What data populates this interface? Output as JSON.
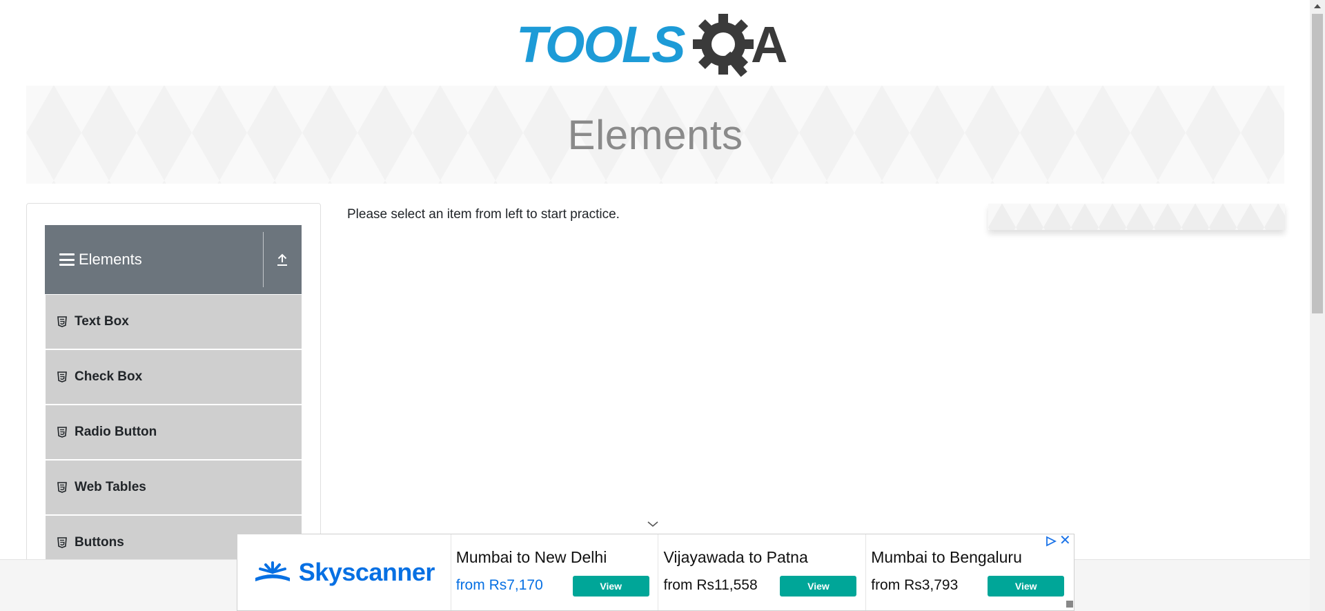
{
  "header": {
    "logo_part1": "TOOLS",
    "logo_part2": "A",
    "logo_icon": "gear-magnifier-icon"
  },
  "banner": {
    "title": "Elements"
  },
  "sidebar": {
    "group_title": "Elements",
    "group_icon": "hamburger-icon",
    "toggle_icon": "collapse-up-icon",
    "items": [
      {
        "label": "Text Box",
        "icon": "html5-icon"
      },
      {
        "label": "Check Box",
        "icon": "html5-icon"
      },
      {
        "label": "Radio Button",
        "icon": "html5-icon"
      },
      {
        "label": "Web Tables",
        "icon": "html5-icon"
      },
      {
        "label": "Buttons",
        "icon": "html5-icon"
      }
    ]
  },
  "main": {
    "instruction": "Please select an item from left to start practice."
  },
  "ad": {
    "brand": "Skyscanner",
    "cards": [
      {
        "route": "Mumbai to New Delhi",
        "price": "from Rs7,170",
        "button": "View"
      },
      {
        "route": "Vijayawada to Patna",
        "price": "from Rs11,558",
        "button": "View"
      },
      {
        "route": "Mumbai to Bengaluru",
        "price": "from Rs3,793",
        "button": "View"
      }
    ],
    "close_icon": "close-icon",
    "adchoices_icon": "adchoices-icon"
  },
  "colors": {
    "logo_blue": "#1d9bd7",
    "logo_dark": "#3a3a3a",
    "sidebar_header": "#6c757d",
    "menu_item": "#cfcfcf",
    "ad_button": "#00a698",
    "ad_brand": "#0770e3"
  }
}
